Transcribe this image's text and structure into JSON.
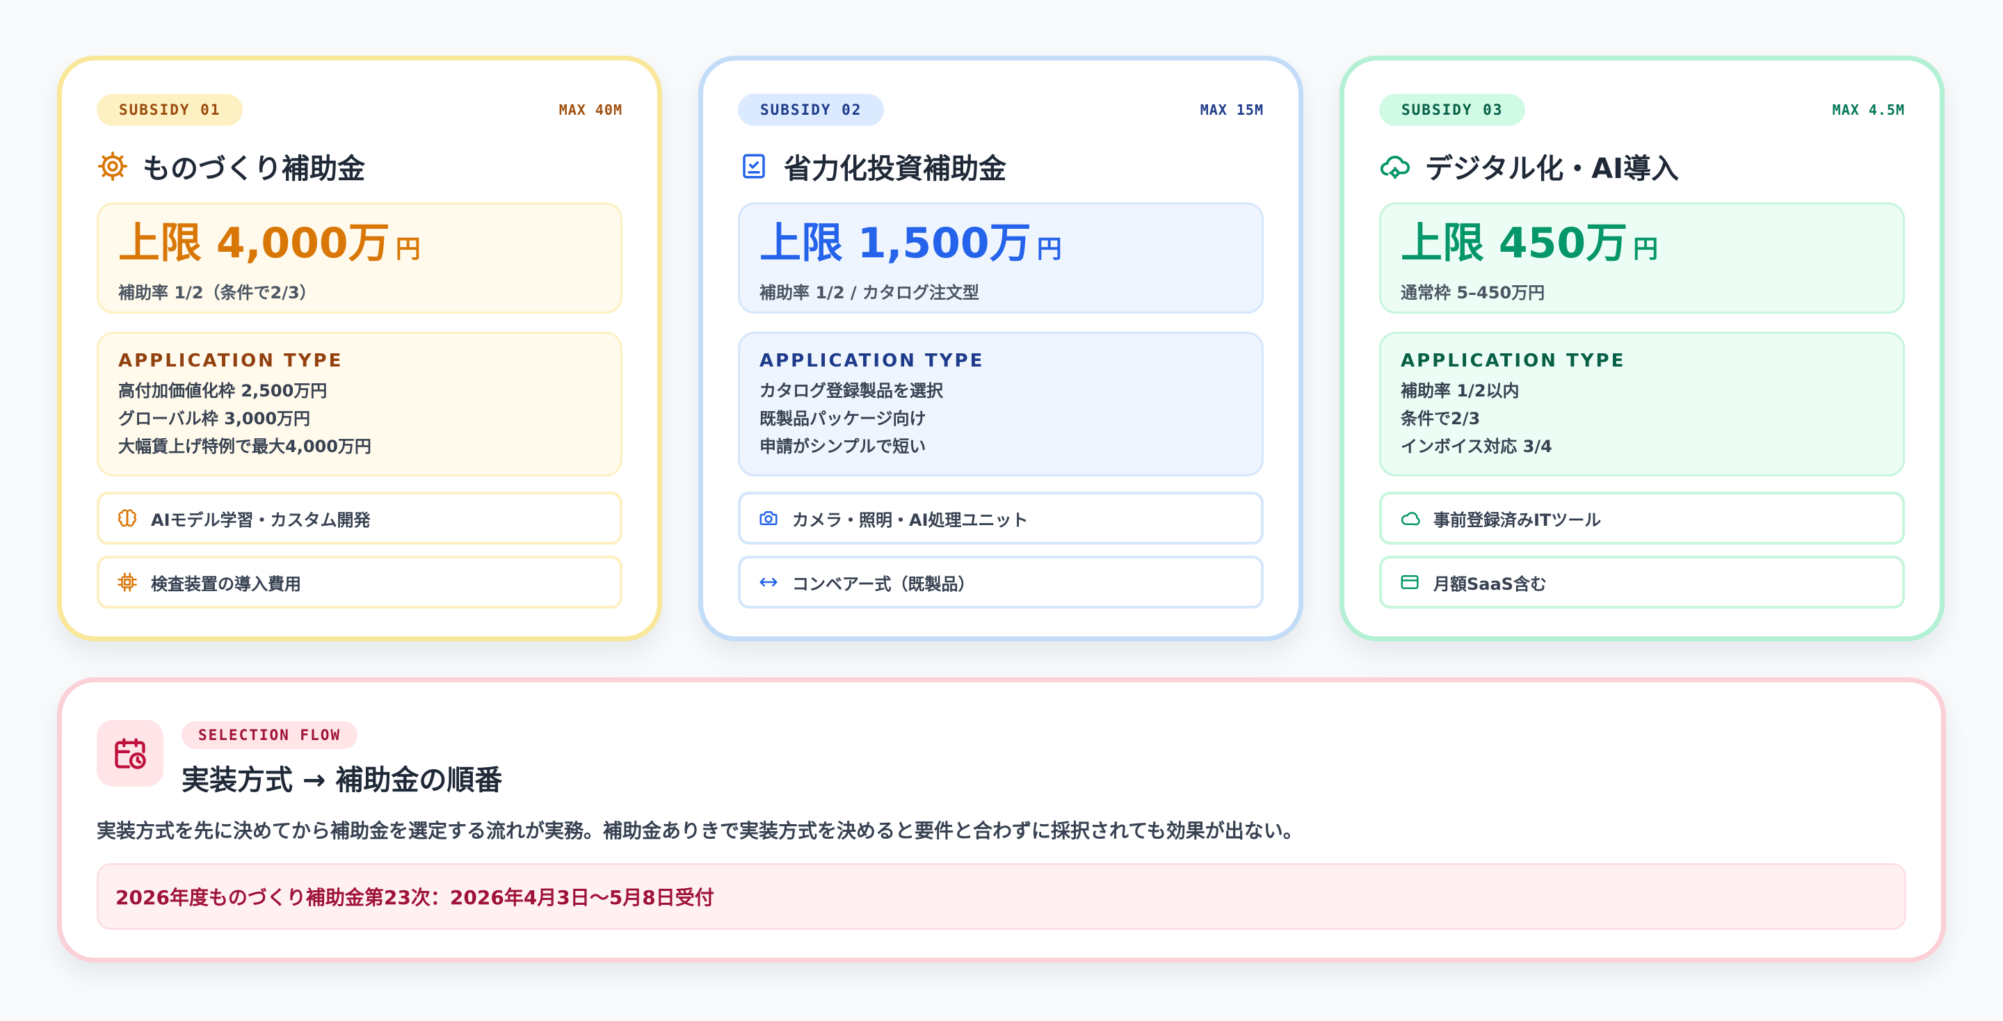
{
  "cards": [
    {
      "badge": "SUBSIDY 01",
      "max": "MAX 40M",
      "title": "ものづくり補助金",
      "title_icon": "gear-cycle-icon",
      "limit": "上限 4,000万",
      "limit_unit": "円",
      "rate": "補助率 1/2（条件で2/3）",
      "app_type_heading": "APPLICATION TYPE",
      "app_lines": [
        "高付加価値化枠 2,500万円",
        "グローバル枠 3,000万円",
        "大幅賃上げ特例で最大4,000万円"
      ],
      "features": [
        {
          "icon": "brain-icon",
          "label": "AIモデル学習・カスタム開発"
        },
        {
          "icon": "chip-icon",
          "label": "検査装置の導入費用"
        }
      ],
      "accent": "#d97706"
    },
    {
      "badge": "SUBSIDY 02",
      "max": "MAX 15M",
      "title": "省力化投資補助金",
      "title_icon": "clipboard-check-icon",
      "limit": "上限 1,500万",
      "limit_unit": "円",
      "rate": "補助率 1/2 / カタログ注文型",
      "app_type_heading": "APPLICATION TYPE",
      "app_lines": [
        "カタログ登録製品を選択",
        "既製品パッケージ向け",
        "申請がシンプルで短い"
      ],
      "features": [
        {
          "icon": "camera-icon",
          "label": "カメラ・照明・AI処理ユニット"
        },
        {
          "icon": "arrows-horizontal-icon",
          "label": "コンベアー式（既製品）"
        }
      ],
      "accent": "#2563eb"
    },
    {
      "badge": "SUBSIDY 03",
      "max": "MAX 4.5M",
      "title": "デジタル化・AI導入",
      "title_icon": "cloud-gear-icon",
      "limit": "上限 450万",
      "limit_unit": "円",
      "rate": "通常枠 5–450万円",
      "app_type_heading": "APPLICATION TYPE",
      "app_lines": [
        "補助率 1/2以内",
        "条件で2/3",
        "インボイス対応 3/4"
      ],
      "features": [
        {
          "icon": "cloud-icon",
          "label": "事前登録済みITツール"
        },
        {
          "icon": "credit-card-icon",
          "label": "月額SaaS含む"
        }
      ],
      "accent": "#059669"
    }
  ],
  "flow": {
    "icon": "calendar-clock-icon",
    "badge": "SELECTION FLOW",
    "title": "実装方式 → 補助金の順番",
    "description": "実装方式を先に決めてから補助金を選定する流れが実務。補助金ありきで実装方式を決めると要件と合わずに採択されても効果が出ない。",
    "deadline": "2026年度ものづくり補助金第23次：2026年4月3日〜5月8日受付",
    "accent": "#9f1239"
  }
}
